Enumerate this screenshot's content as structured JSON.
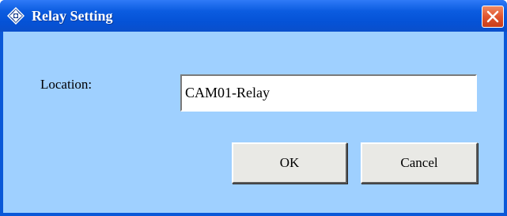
{
  "window": {
    "title": "Relay Setting",
    "title_icon": "diamond-arrows-icon",
    "close_icon": "close-icon"
  },
  "form": {
    "location_label": "Location:",
    "location_value": "CAM01-Relay"
  },
  "buttons": {
    "ok_label": "OK",
    "cancel_label": "Cancel"
  },
  "colors": {
    "titlebar": "#0552d6",
    "client_background": "#9fd0ff",
    "button_face": "#e9e9e5",
    "close_button": "#e0552f"
  }
}
